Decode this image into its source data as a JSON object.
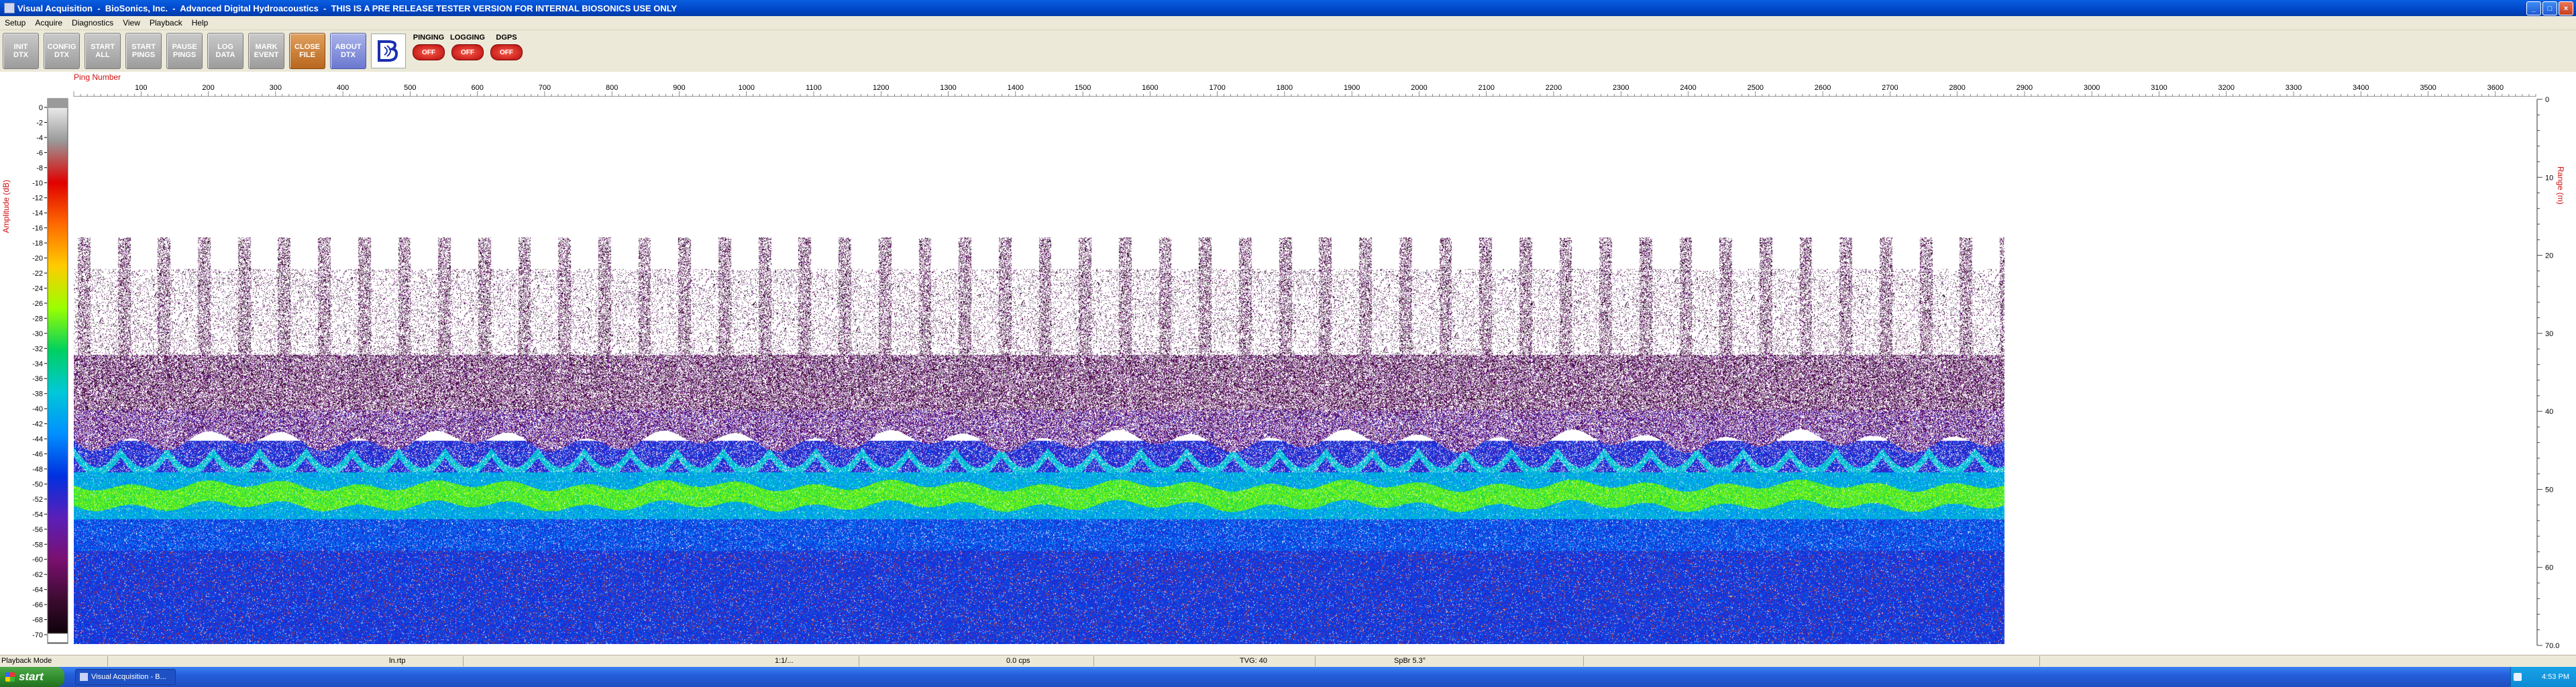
{
  "window": {
    "title": "Visual Acquisition  -  BioSonics, Inc.  -  Advanced Digital Hydroacoustics  -  THIS IS A PRE RELEASE TESTER VERSION FOR INTERNAL BIOSONICS USE ONLY",
    "minimize": "_",
    "maximize": "□",
    "close": "×"
  },
  "menu": [
    "Setup",
    "Acquire",
    "Diagnostics",
    "View",
    "Playback",
    "Help"
  ],
  "toolbar": {
    "buttons": [
      {
        "label": "INIT\nDTX"
      },
      {
        "label": "CONFIG\nDTX"
      },
      {
        "label": "START\nALL"
      },
      {
        "label": "START\nPINGS"
      },
      {
        "label": "PAUSE\nPINGS"
      },
      {
        "label": "LOG\nDATA"
      },
      {
        "label": "MARK\nEVENT"
      },
      {
        "label": "CLOSE\nFILE"
      },
      {
        "label": "ABOUT\nDTX"
      }
    ],
    "indicators": [
      {
        "label": "PINGING",
        "state": "OFF"
      },
      {
        "label": "LOGGING",
        "state": "OFF"
      },
      {
        "label": "DGPS",
        "state": "OFF"
      }
    ]
  },
  "echogram": {
    "ping_axis_label": "Ping Number",
    "amplitude_axis_label": "Amplitude (dB)",
    "range_axis_label": "Range (m)",
    "ping_ticks": [
      100,
      200,
      300,
      400,
      500,
      600,
      700,
      800,
      900,
      1000,
      1100,
      1200,
      1300,
      1400,
      1500,
      1600,
      1700,
      1800,
      1900,
      2000,
      2100,
      2200,
      2300,
      2400,
      2500,
      2600,
      2700,
      2800,
      2900,
      3000,
      3100,
      3200,
      3300,
      3400,
      3500,
      3600
    ],
    "ping_max_shown": 3660,
    "pings_recorded": 2870,
    "amplitude_ticks": [
      0,
      -2,
      -4,
      -6,
      -8,
      -10,
      -12,
      -14,
      -16,
      -18,
      -20,
      -22,
      -24,
      -26,
      -28,
      -30,
      -32,
      -34,
      -36,
      -38,
      -40,
      -42,
      -44,
      -46,
      -48,
      -50,
      -52,
      -54,
      -56,
      -58,
      -60,
      -62,
      -64,
      -66,
      -68,
      -70
    ],
    "range_ticks": [
      "0",
      "10",
      "20",
      "30",
      "40",
      "50",
      "60",
      "70.0"
    ],
    "range_max": 70
  },
  "colors": {
    "colormap": [
      "#ffffff",
      "#9a9a9a",
      "#e00000",
      "#ff6a00",
      "#ffcc00",
      "#9aff00",
      "#00d060",
      "#00c8d8",
      "#0090ff",
      "#0030e0",
      "#5a1fb8",
      "#7a1070",
      "#3a0a2e",
      "#000000"
    ],
    "accent_red": "#d01010"
  },
  "statusbar": [
    "Playback Mode",
    "ln.rtp",
    "1:1/...",
    "0.0 cps",
    "TVG: 40",
    "SpBr 5.3°"
  ],
  "taskbar": {
    "start": "start",
    "task": "Visual Acquisition  -  B...",
    "clock": "4:53 PM"
  }
}
